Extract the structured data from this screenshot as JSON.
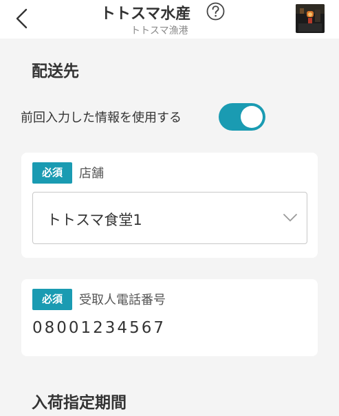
{
  "header": {
    "title": "トトスマ水産",
    "subtitle": "トトスマ漁港",
    "icons": {
      "back": "chevron-left-icon",
      "help": "question-circle-icon",
      "avatar": "shop-avatar"
    }
  },
  "sections": {
    "delivery_title": "配送先",
    "arrival_title": "入荷指定期間"
  },
  "use_previous": {
    "label": "前回入力した情報を使用する",
    "enabled": true
  },
  "store_field": {
    "badge": "必須",
    "label": "店舗",
    "value": "トトスマ食堂1"
  },
  "phone_field": {
    "badge": "必須",
    "label": "受取人電話番号",
    "value": "08001234567"
  },
  "colors": {
    "accent": "#1a9bb2",
    "background": "#f4f4f4",
    "card": "#ffffff"
  }
}
